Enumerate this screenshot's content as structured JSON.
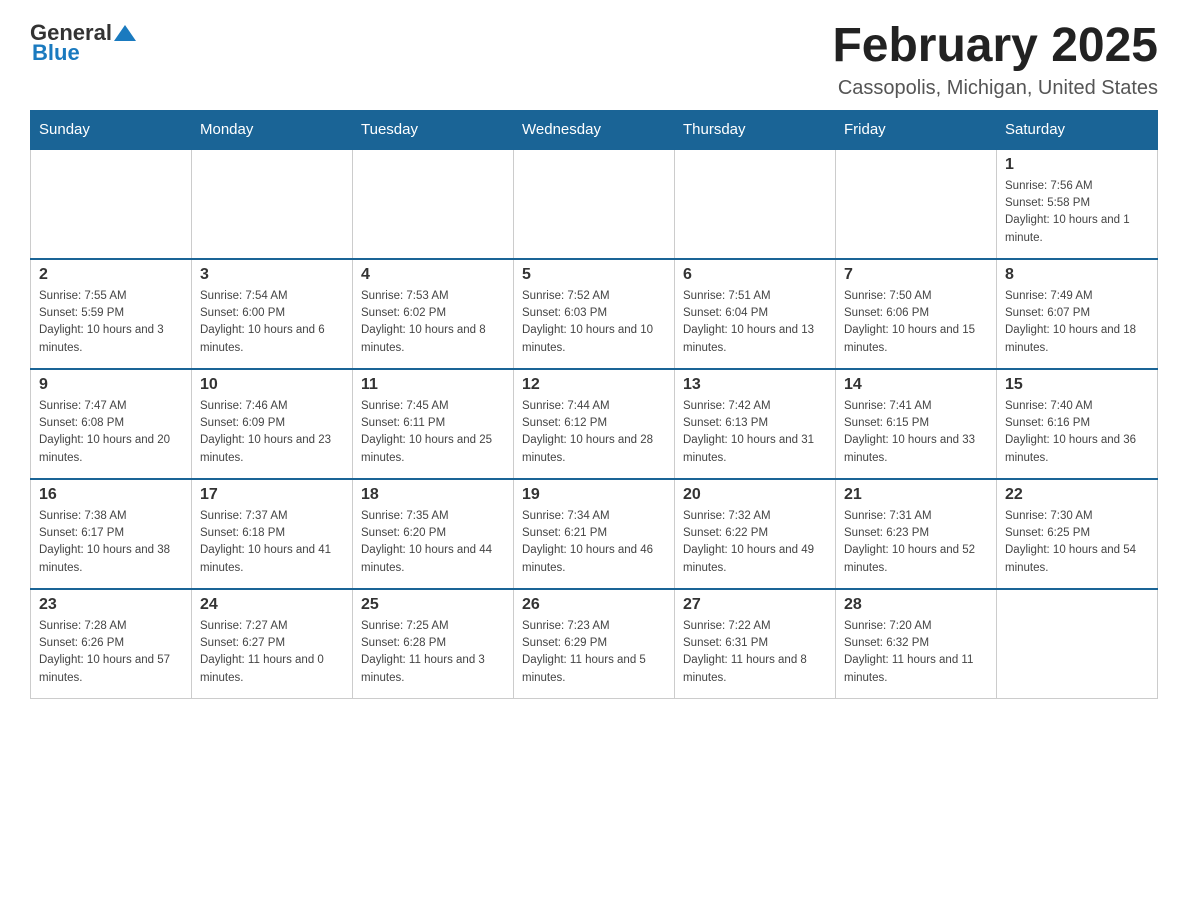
{
  "logo": {
    "text_general": "General",
    "text_blue": "Blue"
  },
  "header": {
    "month_title": "February 2025",
    "location": "Cassopolis, Michigan, United States"
  },
  "days_of_week": [
    "Sunday",
    "Monday",
    "Tuesday",
    "Wednesday",
    "Thursday",
    "Friday",
    "Saturday"
  ],
  "weeks": [
    [
      {
        "day": "",
        "sunrise": "",
        "sunset": "",
        "daylight": ""
      },
      {
        "day": "",
        "sunrise": "",
        "sunset": "",
        "daylight": ""
      },
      {
        "day": "",
        "sunrise": "",
        "sunset": "",
        "daylight": ""
      },
      {
        "day": "",
        "sunrise": "",
        "sunset": "",
        "daylight": ""
      },
      {
        "day": "",
        "sunrise": "",
        "sunset": "",
        "daylight": ""
      },
      {
        "day": "",
        "sunrise": "",
        "sunset": "",
        "daylight": ""
      },
      {
        "day": "1",
        "sunrise": "Sunrise: 7:56 AM",
        "sunset": "Sunset: 5:58 PM",
        "daylight": "Daylight: 10 hours and 1 minute."
      }
    ],
    [
      {
        "day": "2",
        "sunrise": "Sunrise: 7:55 AM",
        "sunset": "Sunset: 5:59 PM",
        "daylight": "Daylight: 10 hours and 3 minutes."
      },
      {
        "day": "3",
        "sunrise": "Sunrise: 7:54 AM",
        "sunset": "Sunset: 6:00 PM",
        "daylight": "Daylight: 10 hours and 6 minutes."
      },
      {
        "day": "4",
        "sunrise": "Sunrise: 7:53 AM",
        "sunset": "Sunset: 6:02 PM",
        "daylight": "Daylight: 10 hours and 8 minutes."
      },
      {
        "day": "5",
        "sunrise": "Sunrise: 7:52 AM",
        "sunset": "Sunset: 6:03 PM",
        "daylight": "Daylight: 10 hours and 10 minutes."
      },
      {
        "day": "6",
        "sunrise": "Sunrise: 7:51 AM",
        "sunset": "Sunset: 6:04 PM",
        "daylight": "Daylight: 10 hours and 13 minutes."
      },
      {
        "day": "7",
        "sunrise": "Sunrise: 7:50 AM",
        "sunset": "Sunset: 6:06 PM",
        "daylight": "Daylight: 10 hours and 15 minutes."
      },
      {
        "day": "8",
        "sunrise": "Sunrise: 7:49 AM",
        "sunset": "Sunset: 6:07 PM",
        "daylight": "Daylight: 10 hours and 18 minutes."
      }
    ],
    [
      {
        "day": "9",
        "sunrise": "Sunrise: 7:47 AM",
        "sunset": "Sunset: 6:08 PM",
        "daylight": "Daylight: 10 hours and 20 minutes."
      },
      {
        "day": "10",
        "sunrise": "Sunrise: 7:46 AM",
        "sunset": "Sunset: 6:09 PM",
        "daylight": "Daylight: 10 hours and 23 minutes."
      },
      {
        "day": "11",
        "sunrise": "Sunrise: 7:45 AM",
        "sunset": "Sunset: 6:11 PM",
        "daylight": "Daylight: 10 hours and 25 minutes."
      },
      {
        "day": "12",
        "sunrise": "Sunrise: 7:44 AM",
        "sunset": "Sunset: 6:12 PM",
        "daylight": "Daylight: 10 hours and 28 minutes."
      },
      {
        "day": "13",
        "sunrise": "Sunrise: 7:42 AM",
        "sunset": "Sunset: 6:13 PM",
        "daylight": "Daylight: 10 hours and 31 minutes."
      },
      {
        "day": "14",
        "sunrise": "Sunrise: 7:41 AM",
        "sunset": "Sunset: 6:15 PM",
        "daylight": "Daylight: 10 hours and 33 minutes."
      },
      {
        "day": "15",
        "sunrise": "Sunrise: 7:40 AM",
        "sunset": "Sunset: 6:16 PM",
        "daylight": "Daylight: 10 hours and 36 minutes."
      }
    ],
    [
      {
        "day": "16",
        "sunrise": "Sunrise: 7:38 AM",
        "sunset": "Sunset: 6:17 PM",
        "daylight": "Daylight: 10 hours and 38 minutes."
      },
      {
        "day": "17",
        "sunrise": "Sunrise: 7:37 AM",
        "sunset": "Sunset: 6:18 PM",
        "daylight": "Daylight: 10 hours and 41 minutes."
      },
      {
        "day": "18",
        "sunrise": "Sunrise: 7:35 AM",
        "sunset": "Sunset: 6:20 PM",
        "daylight": "Daylight: 10 hours and 44 minutes."
      },
      {
        "day": "19",
        "sunrise": "Sunrise: 7:34 AM",
        "sunset": "Sunset: 6:21 PM",
        "daylight": "Daylight: 10 hours and 46 minutes."
      },
      {
        "day": "20",
        "sunrise": "Sunrise: 7:32 AM",
        "sunset": "Sunset: 6:22 PM",
        "daylight": "Daylight: 10 hours and 49 minutes."
      },
      {
        "day": "21",
        "sunrise": "Sunrise: 7:31 AM",
        "sunset": "Sunset: 6:23 PM",
        "daylight": "Daylight: 10 hours and 52 minutes."
      },
      {
        "day": "22",
        "sunrise": "Sunrise: 7:30 AM",
        "sunset": "Sunset: 6:25 PM",
        "daylight": "Daylight: 10 hours and 54 minutes."
      }
    ],
    [
      {
        "day": "23",
        "sunrise": "Sunrise: 7:28 AM",
        "sunset": "Sunset: 6:26 PM",
        "daylight": "Daylight: 10 hours and 57 minutes."
      },
      {
        "day": "24",
        "sunrise": "Sunrise: 7:27 AM",
        "sunset": "Sunset: 6:27 PM",
        "daylight": "Daylight: 11 hours and 0 minutes."
      },
      {
        "day": "25",
        "sunrise": "Sunrise: 7:25 AM",
        "sunset": "Sunset: 6:28 PM",
        "daylight": "Daylight: 11 hours and 3 minutes."
      },
      {
        "day": "26",
        "sunrise": "Sunrise: 7:23 AM",
        "sunset": "Sunset: 6:29 PM",
        "daylight": "Daylight: 11 hours and 5 minutes."
      },
      {
        "day": "27",
        "sunrise": "Sunrise: 7:22 AM",
        "sunset": "Sunset: 6:31 PM",
        "daylight": "Daylight: 11 hours and 8 minutes."
      },
      {
        "day": "28",
        "sunrise": "Sunrise: 7:20 AM",
        "sunset": "Sunset: 6:32 PM",
        "daylight": "Daylight: 11 hours and 11 minutes."
      },
      {
        "day": "",
        "sunrise": "",
        "sunset": "",
        "daylight": ""
      }
    ]
  ]
}
